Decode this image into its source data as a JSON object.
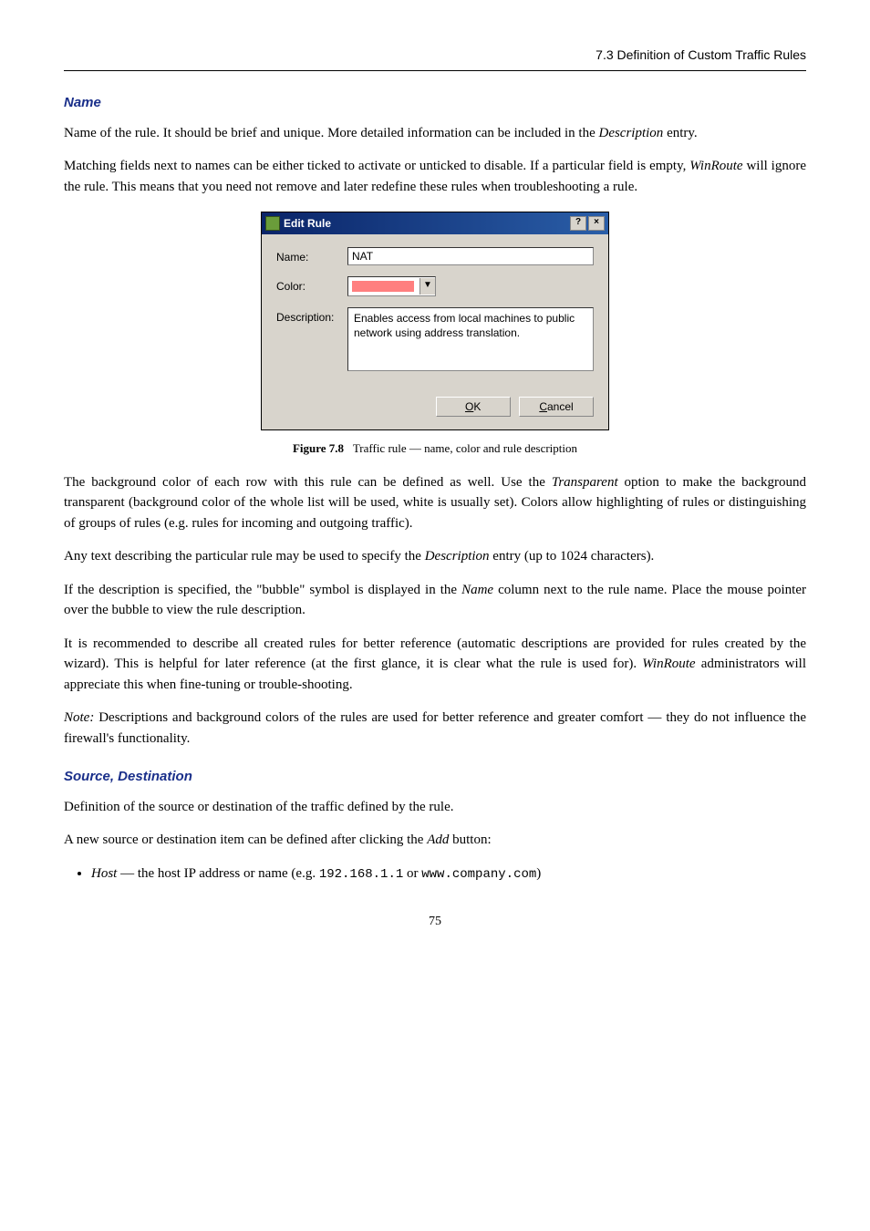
{
  "header": {
    "section_label": "7.3  Definition of Custom Traffic Rules"
  },
  "sec_name": {
    "title": "Name",
    "p1a": "Name of the rule. It should be brief and unique. More detailed information can be included in the ",
    "p1b": "Description",
    "p1c": " entry.",
    "p2a": "Matching fields next to names can be either ticked to activate or unticked to disable. If a particular field is empty, ",
    "p2b": "WinRoute",
    "p2c": " will ignore the rule. This means that you need not remove and later redefine these rules when troubleshooting a rule."
  },
  "dialog": {
    "title": "Edit Rule",
    "help_btn": "?",
    "close_btn": "×",
    "name_label": "Name:",
    "name_value": "NAT",
    "color_label": "Color:",
    "dropdown_glyph": "▼",
    "desc_label": "Description:",
    "desc_value": "Enables access from local machines to public network using address translation.",
    "ok_label": "OK",
    "cancel_label": "Cancel"
  },
  "figure": {
    "label": "Figure 7.8",
    "caption": "Traffic rule — name, color and rule description"
  },
  "after_fig": {
    "p1a": "The background color of each row with this rule can be defined as well. Use the ",
    "p1b": "Transparent",
    "p1c": " option to make the background transparent (background color of the whole list will be used, white is usually set). Colors allow highlighting of rules or distinguishing of groups of rules (e.g. rules for incoming and outgoing traffic).",
    "p2a": "Any text describing the particular rule may be used to specify the ",
    "p2b": "Description",
    "p2c": " entry (up to 1024 characters).",
    "p3a": "If the description is specified, the \"bubble\" symbol is displayed in the ",
    "p3b": "Name",
    "p3c": " column next to the rule name. Place the mouse pointer over the bubble to view the rule description.",
    "p4a": "It is recommended to describe all created rules for better reference (automatic descriptions are provided for rules created by the wizard). This is helpful for later reference (at the first glance, it is clear what the rule is used for). ",
    "p4b": "WinRoute",
    "p4c": " administrators will appreciate this when fine-tuning or trouble-shooting.",
    "p5a": "Note:",
    "p5b": " Descriptions and background colors of the rules are used for better reference and greater comfort — they do not influence the firewall's functionality."
  },
  "sec_srcdst": {
    "title": "Source, Destination",
    "p1": "Definition of the source or destination of the traffic defined by the rule.",
    "p2a": "A new source or destination item can be defined after clicking the ",
    "p2b": "Add",
    "p2c": " button:",
    "bullet_a": "Host",
    "bullet_b": " — the host IP address or name (e.g. ",
    "bullet_c": "192.168.1.1",
    "bullet_d": " or ",
    "bullet_e": "www.company.com",
    "bullet_f": ")"
  },
  "page_number": "75"
}
